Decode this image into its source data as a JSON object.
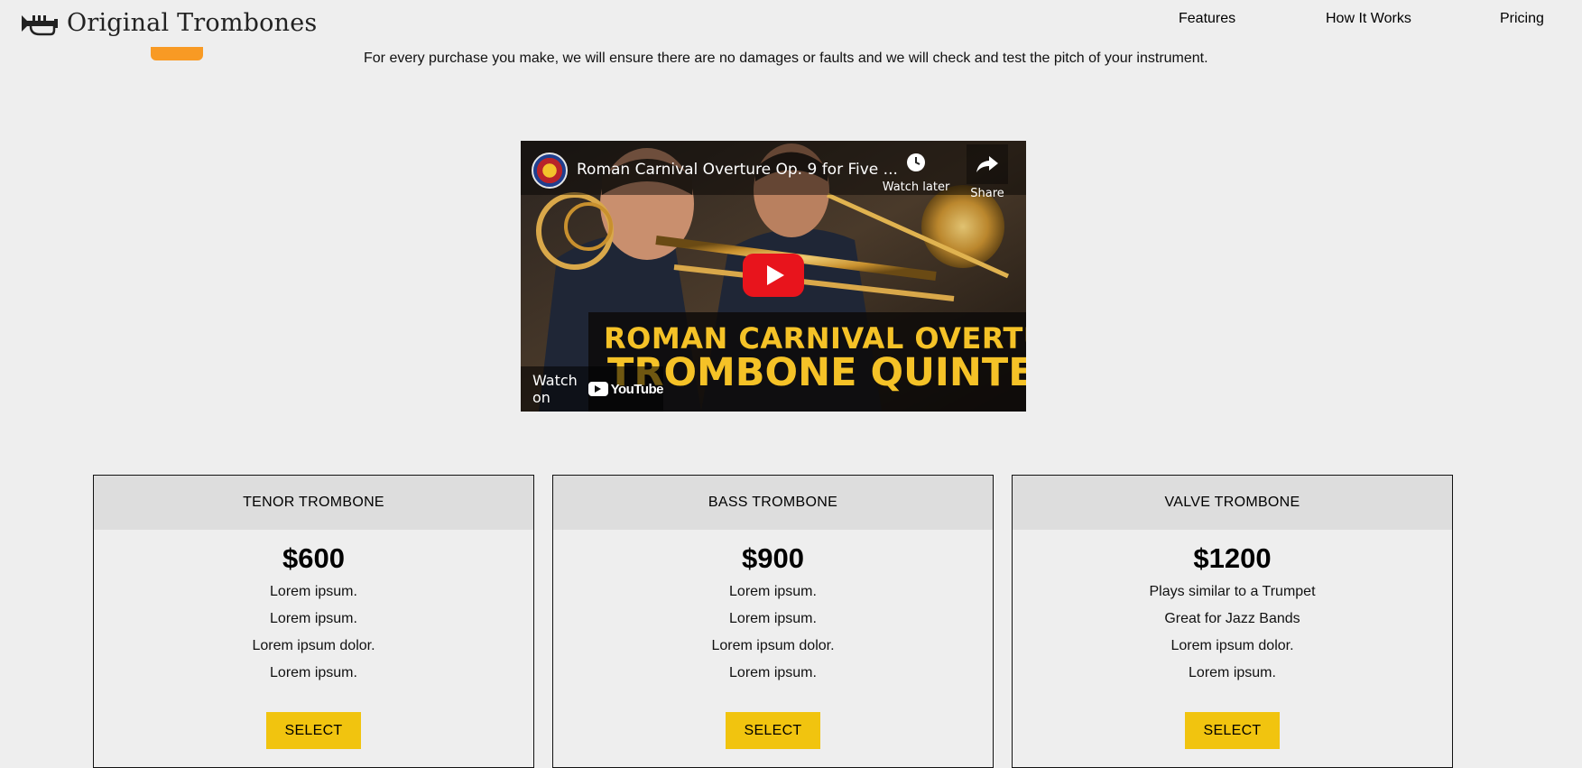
{
  "header": {
    "brand": "Original Trombones",
    "logo_icon": "trumpet-icon",
    "nav": [
      {
        "label": "Features"
      },
      {
        "label": "How It Works"
      },
      {
        "label": "Pricing"
      }
    ]
  },
  "guarantee": {
    "text": "For every purchase you make, we will ensure there are no damages or faults and we will check and test the pitch of your instrument."
  },
  "video": {
    "title": "Roman Carnival Overture Op. 9 for Five ...",
    "watch_later": "Watch later",
    "share": "Share",
    "banner_line1": "ROMAN CARNIVAL OVERTURE",
    "banner_line2": "TROMBONE QUINTET",
    "watch_on": "Watch on",
    "youtube_word": "YouTube"
  },
  "pricing": [
    {
      "name": "TENOR TROMBONE",
      "price": "$600",
      "features": [
        "Lorem ipsum.",
        "Lorem ipsum.",
        "Lorem ipsum dolor.",
        "Lorem ipsum."
      ],
      "button": "SELECT"
    },
    {
      "name": "BASS TROMBONE",
      "price": "$900",
      "features": [
        "Lorem ipsum.",
        "Lorem ipsum.",
        "Lorem ipsum dolor.",
        "Lorem ipsum."
      ],
      "button": "SELECT"
    },
    {
      "name": "VALVE TROMBONE",
      "price": "$1200",
      "features": [
        "Plays similar to a Trumpet",
        "Great for Jazz Bands",
        "Lorem ipsum dolor.",
        "Lorem ipsum."
      ],
      "button": "SELECT"
    }
  ],
  "colors": {
    "background": "#eeeeee",
    "card_header": "#dddddd",
    "select_button": "#f1c40f",
    "orange_accent": "#f89a24",
    "banner_text": "#f5c227",
    "play_button": "#e8141c"
  }
}
